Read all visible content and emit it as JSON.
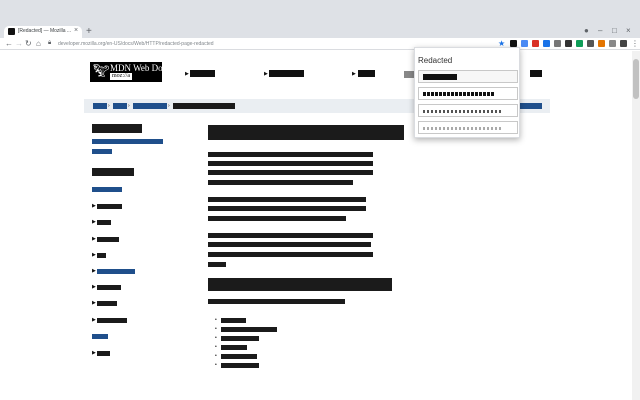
{
  "browser": {
    "tab_title": "[Redacted] — Mozilla ...",
    "tab_close_glyph": "×",
    "new_tab_glyph": "+",
    "url": "developer.mozilla.org/en-US/docs/Web/HTTP/redacted-page-redacted",
    "nav_back": "←",
    "nav_forward": "→",
    "nav_reload": "↻",
    "nav_home": "⌂",
    "star_glyph": "★",
    "win_min": "–",
    "win_max": "□",
    "win_close": "×",
    "menu_glyph": "⋮"
  },
  "site": {
    "logo_text": "MDN Web Docs",
    "logo_sub": "moz://a"
  },
  "popup": {
    "title": "Redacted"
  },
  "icons": {
    "logo": "dino-icon",
    "bullets": "triangle-right-icon"
  }
}
